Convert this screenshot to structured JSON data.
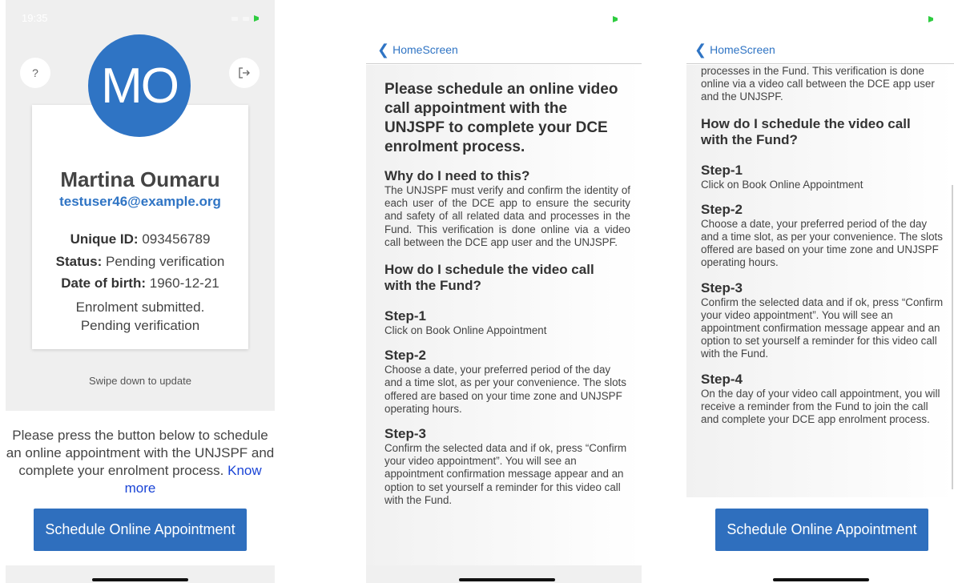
{
  "status": {
    "time": "19:35"
  },
  "profile": {
    "avatar_initials": "MO",
    "name": "Martina Oumaru",
    "email": "testuser46@example.org",
    "unique_id_label": "Unique ID:",
    "unique_id": "093456789",
    "status_label": "Status:",
    "status_value": "Pending verification",
    "dob_label": "Date of birth:",
    "dob_value": "1960-12-21",
    "enrolment_line1": "Enrolment submitted.",
    "enrolment_line2": "Pending verification"
  },
  "swipe_hint": "Swipe down to update",
  "instruction": {
    "text": "Please press the button below to schedule an online appointment with the UNJSPF and complete your enrolment process.",
    "know_more": "Know more"
  },
  "schedule_button_label": "Schedule Online Appointment",
  "nav": {
    "back_label": "HomeScreen"
  },
  "article": {
    "title": "Please schedule an online video call appointment with the UNJSPF to complete your DCE enrolment process.",
    "why_heading": "Why do I need to this?",
    "why_body": "The UNJSPF must verify and confirm the identity of each user of the DCE app to ensure the security and safety of all related data and processes in the Fund. This verification is done online via a video call between the DCE app user and the UNJSPF.",
    "why_body_tail": "processes in the Fund. This verification is done online via a video call between the DCE app user and the UNJSPF.",
    "how_heading": "How do I schedule the video call with the Fund?",
    "steps": [
      {
        "title": "Step-1",
        "body": "Click on Book Online Appointment"
      },
      {
        "title": "Step-2",
        "body": "Choose a date, your preferred period of the day and a time slot, as per your convenience. The slots offered are based on your time zone and UNJSPF operating hours."
      },
      {
        "title": "Step-3",
        "body": "Confirm the selected data and if ok, press “Confirm your video appointment”. You will see an appointment confirmation message appear and an option to set yourself a reminder for this video call with the Fund."
      },
      {
        "title": "Step-4",
        "body": "On the day of your video call appointment, you will receive a reminder from the Fund to join the call and complete your DCE app enrolment process."
      }
    ]
  },
  "colors": {
    "accent": "#2f74c4",
    "button": "#2f6fbe",
    "link": "#1a44d6"
  }
}
